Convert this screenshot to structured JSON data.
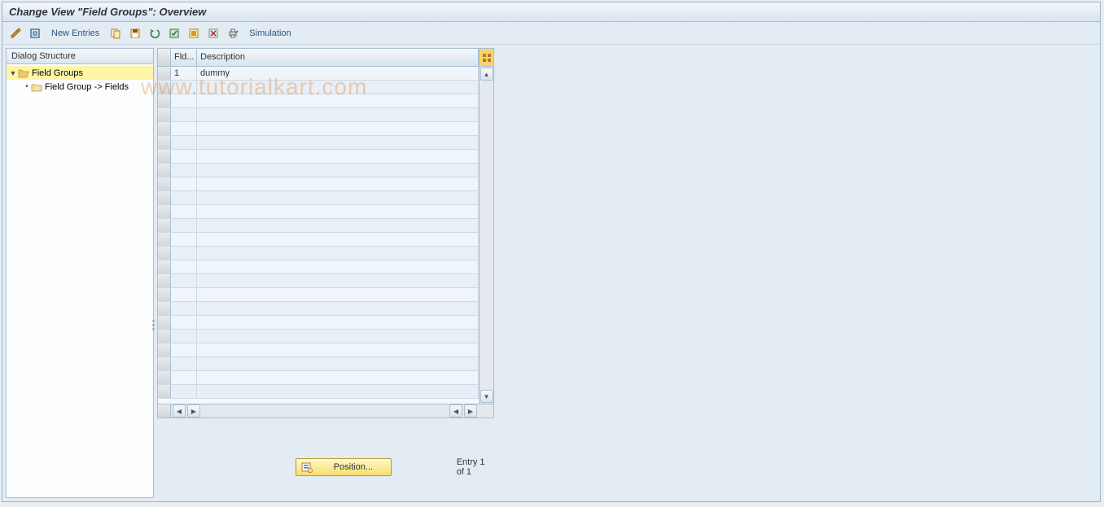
{
  "title": "Change View \"Field Groups\": Overview",
  "toolbar": {
    "new_entries": "New Entries",
    "simulation": "Simulation"
  },
  "dialog_structure": {
    "header": "Dialog Structure",
    "nodes": [
      {
        "label": "Field Groups",
        "selected": true,
        "open": true
      },
      {
        "label": "Field Group -> Fields",
        "selected": false,
        "open": false
      }
    ]
  },
  "table": {
    "columns": {
      "fld": "Fld...",
      "desc": "Description"
    },
    "rows": [
      {
        "fld": "1",
        "desc": "dummy"
      },
      {
        "fld": "",
        "desc": ""
      },
      {
        "fld": "",
        "desc": ""
      },
      {
        "fld": "",
        "desc": ""
      },
      {
        "fld": "",
        "desc": ""
      },
      {
        "fld": "",
        "desc": ""
      },
      {
        "fld": "",
        "desc": ""
      },
      {
        "fld": "",
        "desc": ""
      },
      {
        "fld": "",
        "desc": ""
      },
      {
        "fld": "",
        "desc": ""
      },
      {
        "fld": "",
        "desc": ""
      },
      {
        "fld": "",
        "desc": ""
      },
      {
        "fld": "",
        "desc": ""
      },
      {
        "fld": "",
        "desc": ""
      },
      {
        "fld": "",
        "desc": ""
      },
      {
        "fld": "",
        "desc": ""
      },
      {
        "fld": "",
        "desc": ""
      },
      {
        "fld": "",
        "desc": ""
      },
      {
        "fld": "",
        "desc": ""
      },
      {
        "fld": "",
        "desc": ""
      },
      {
        "fld": "",
        "desc": ""
      },
      {
        "fld": "",
        "desc": ""
      },
      {
        "fld": "",
        "desc": ""
      },
      {
        "fld": "",
        "desc": ""
      }
    ]
  },
  "footer": {
    "position_label": "Position...",
    "entry_text": "Entry 1 of 1"
  },
  "watermark": "www.tutorialkart.com"
}
